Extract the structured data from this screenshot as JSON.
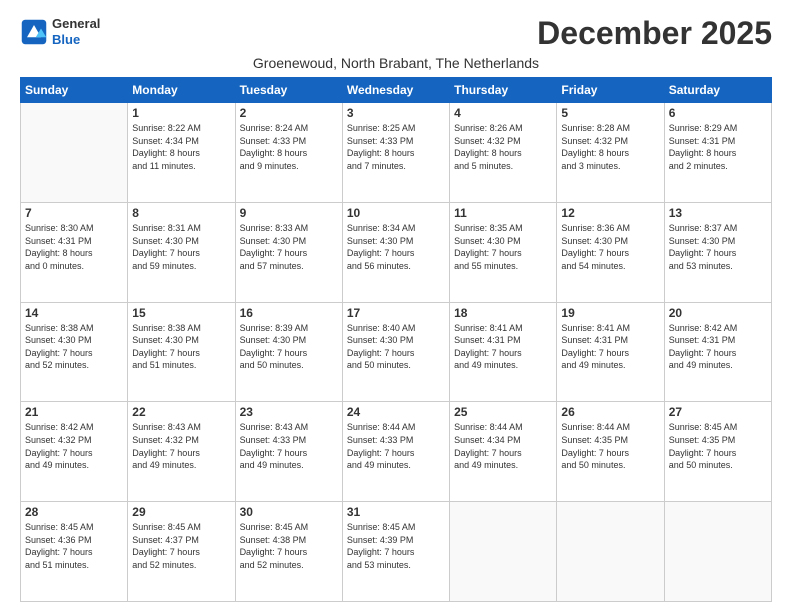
{
  "logo": {
    "general": "General",
    "blue": "Blue"
  },
  "header": {
    "month": "December 2025",
    "subtitle": "Groenewoud, North Brabant, The Netherlands"
  },
  "weekdays": [
    "Sunday",
    "Monday",
    "Tuesday",
    "Wednesday",
    "Thursday",
    "Friday",
    "Saturday"
  ],
  "weeks": [
    [
      {
        "day": "",
        "text": ""
      },
      {
        "day": "1",
        "text": "Sunrise: 8:22 AM\nSunset: 4:34 PM\nDaylight: 8 hours\nand 11 minutes."
      },
      {
        "day": "2",
        "text": "Sunrise: 8:24 AM\nSunset: 4:33 PM\nDaylight: 8 hours\nand 9 minutes."
      },
      {
        "day": "3",
        "text": "Sunrise: 8:25 AM\nSunset: 4:33 PM\nDaylight: 8 hours\nand 7 minutes."
      },
      {
        "day": "4",
        "text": "Sunrise: 8:26 AM\nSunset: 4:32 PM\nDaylight: 8 hours\nand 5 minutes."
      },
      {
        "day": "5",
        "text": "Sunrise: 8:28 AM\nSunset: 4:32 PM\nDaylight: 8 hours\nand 3 minutes."
      },
      {
        "day": "6",
        "text": "Sunrise: 8:29 AM\nSunset: 4:31 PM\nDaylight: 8 hours\nand 2 minutes."
      }
    ],
    [
      {
        "day": "7",
        "text": "Sunrise: 8:30 AM\nSunset: 4:31 PM\nDaylight: 8 hours\nand 0 minutes."
      },
      {
        "day": "8",
        "text": "Sunrise: 8:31 AM\nSunset: 4:30 PM\nDaylight: 7 hours\nand 59 minutes."
      },
      {
        "day": "9",
        "text": "Sunrise: 8:33 AM\nSunset: 4:30 PM\nDaylight: 7 hours\nand 57 minutes."
      },
      {
        "day": "10",
        "text": "Sunrise: 8:34 AM\nSunset: 4:30 PM\nDaylight: 7 hours\nand 56 minutes."
      },
      {
        "day": "11",
        "text": "Sunrise: 8:35 AM\nSunset: 4:30 PM\nDaylight: 7 hours\nand 55 minutes."
      },
      {
        "day": "12",
        "text": "Sunrise: 8:36 AM\nSunset: 4:30 PM\nDaylight: 7 hours\nand 54 minutes."
      },
      {
        "day": "13",
        "text": "Sunrise: 8:37 AM\nSunset: 4:30 PM\nDaylight: 7 hours\nand 53 minutes."
      }
    ],
    [
      {
        "day": "14",
        "text": "Sunrise: 8:38 AM\nSunset: 4:30 PM\nDaylight: 7 hours\nand 52 minutes."
      },
      {
        "day": "15",
        "text": "Sunrise: 8:38 AM\nSunset: 4:30 PM\nDaylight: 7 hours\nand 51 minutes."
      },
      {
        "day": "16",
        "text": "Sunrise: 8:39 AM\nSunset: 4:30 PM\nDaylight: 7 hours\nand 50 minutes."
      },
      {
        "day": "17",
        "text": "Sunrise: 8:40 AM\nSunset: 4:30 PM\nDaylight: 7 hours\nand 50 minutes."
      },
      {
        "day": "18",
        "text": "Sunrise: 8:41 AM\nSunset: 4:31 PM\nDaylight: 7 hours\nand 49 minutes."
      },
      {
        "day": "19",
        "text": "Sunrise: 8:41 AM\nSunset: 4:31 PM\nDaylight: 7 hours\nand 49 minutes."
      },
      {
        "day": "20",
        "text": "Sunrise: 8:42 AM\nSunset: 4:31 PM\nDaylight: 7 hours\nand 49 minutes."
      }
    ],
    [
      {
        "day": "21",
        "text": "Sunrise: 8:42 AM\nSunset: 4:32 PM\nDaylight: 7 hours\nand 49 minutes."
      },
      {
        "day": "22",
        "text": "Sunrise: 8:43 AM\nSunset: 4:32 PM\nDaylight: 7 hours\nand 49 minutes."
      },
      {
        "day": "23",
        "text": "Sunrise: 8:43 AM\nSunset: 4:33 PM\nDaylight: 7 hours\nand 49 minutes."
      },
      {
        "day": "24",
        "text": "Sunrise: 8:44 AM\nSunset: 4:33 PM\nDaylight: 7 hours\nand 49 minutes."
      },
      {
        "day": "25",
        "text": "Sunrise: 8:44 AM\nSunset: 4:34 PM\nDaylight: 7 hours\nand 49 minutes."
      },
      {
        "day": "26",
        "text": "Sunrise: 8:44 AM\nSunset: 4:35 PM\nDaylight: 7 hours\nand 50 minutes."
      },
      {
        "day": "27",
        "text": "Sunrise: 8:45 AM\nSunset: 4:35 PM\nDaylight: 7 hours\nand 50 minutes."
      }
    ],
    [
      {
        "day": "28",
        "text": "Sunrise: 8:45 AM\nSunset: 4:36 PM\nDaylight: 7 hours\nand 51 minutes."
      },
      {
        "day": "29",
        "text": "Sunrise: 8:45 AM\nSunset: 4:37 PM\nDaylight: 7 hours\nand 52 minutes."
      },
      {
        "day": "30",
        "text": "Sunrise: 8:45 AM\nSunset: 4:38 PM\nDaylight: 7 hours\nand 52 minutes."
      },
      {
        "day": "31",
        "text": "Sunrise: 8:45 AM\nSunset: 4:39 PM\nDaylight: 7 hours\nand 53 minutes."
      },
      {
        "day": "",
        "text": ""
      },
      {
        "day": "",
        "text": ""
      },
      {
        "day": "",
        "text": ""
      }
    ]
  ]
}
